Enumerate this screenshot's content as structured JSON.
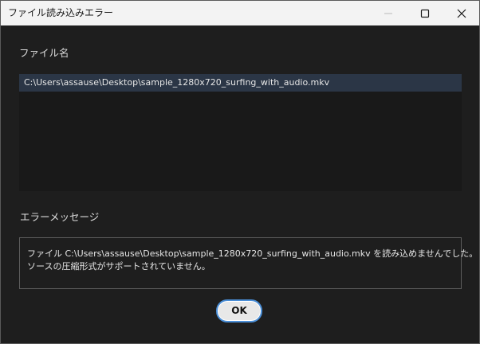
{
  "window": {
    "title": "ファイル読み込みエラー"
  },
  "file_section": {
    "label": "ファイル名",
    "files": [
      "C:\\Users\\assause\\Desktop\\sample_1280x720_surfing_with_audio.mkv"
    ]
  },
  "message_section": {
    "label": "エラーメッセージ",
    "line1": "ファイル C:\\Users\\assause\\Desktop\\sample_1280x720_surfing_with_audio.mkv を読み込めませんでした。",
    "line2": "ソースの圧縮形式がサポートされていません。"
  },
  "buttons": {
    "ok_label": "OK"
  },
  "icons": {
    "minimize": "minimize-icon",
    "maximize": "maximize-icon",
    "close": "close-icon"
  },
  "colors": {
    "accent": "#4b8fd8",
    "selection": "#2b3646"
  }
}
